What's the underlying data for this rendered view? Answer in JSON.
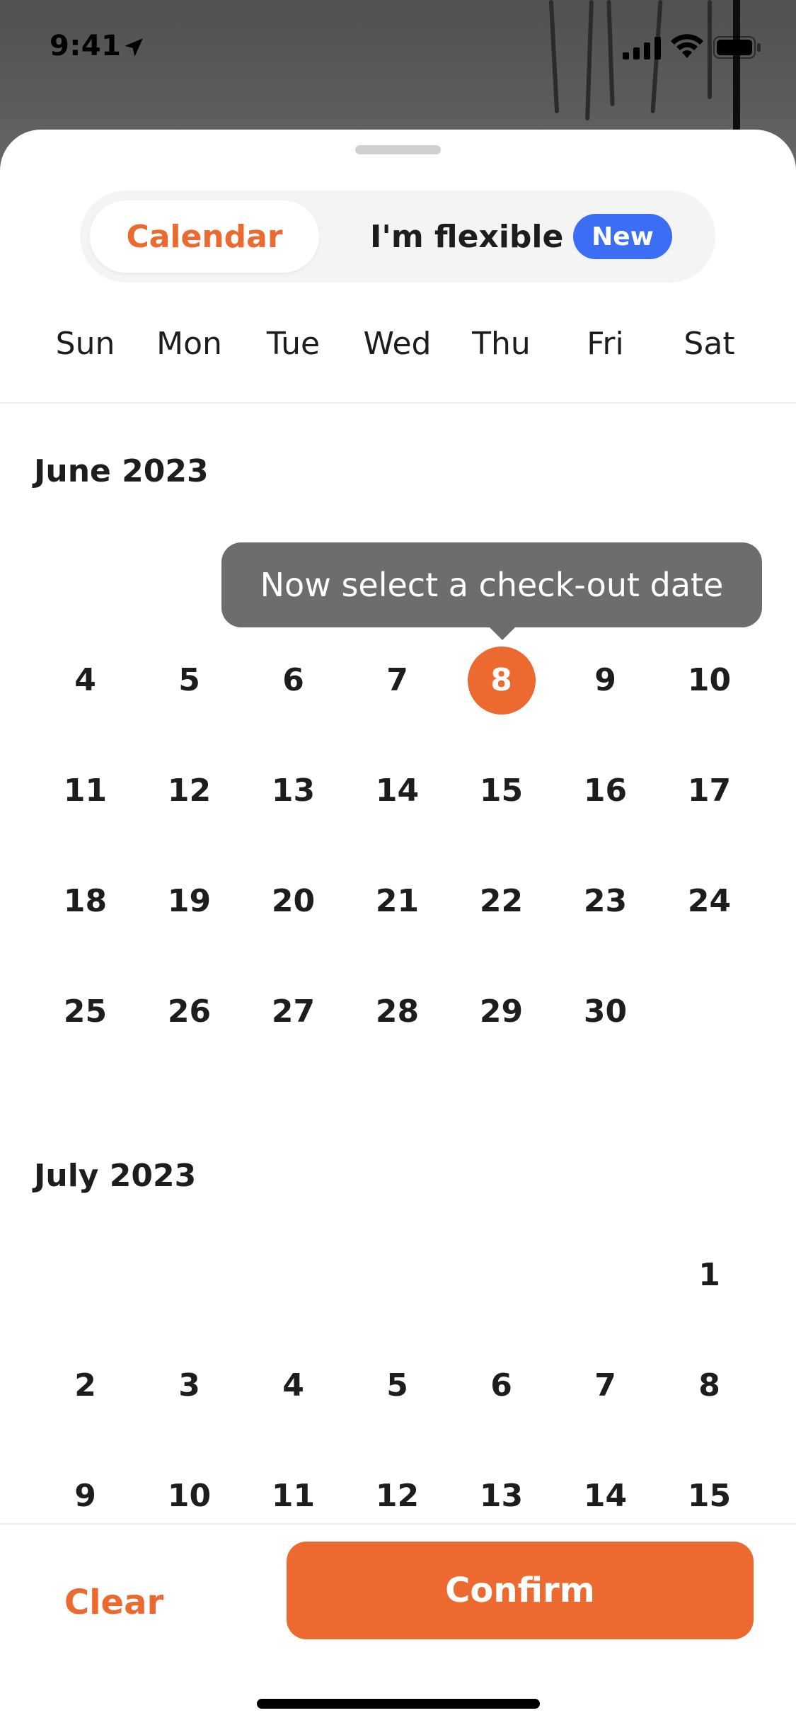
{
  "status_bar": {
    "time": "9:41",
    "icons": [
      "location-arrow-icon",
      "signal-icon",
      "wifi-icon",
      "battery-icon"
    ]
  },
  "segmented": {
    "calendar_label": "Calendar",
    "flexible_label": "I'm flexible",
    "new_badge": "New",
    "active": "Calendar"
  },
  "weekdays": [
    "Sun",
    "Mon",
    "Tue",
    "Wed",
    "Thu",
    "Fri",
    "Sat"
  ],
  "tooltip": "Now select a check-out date",
  "months": [
    {
      "title": "June 2023",
      "first_weekday": 4,
      "days_visible": 30,
      "selected": 8
    },
    {
      "title": "July 2023",
      "first_weekday": 6,
      "days_visible": 15
    }
  ],
  "footer": {
    "clear_label": "Clear",
    "confirm_label": "Confirm"
  },
  "colors": {
    "accent": "#ec6a2f",
    "badge": "#3b6ef5",
    "tooltip": "#6d6d6d"
  }
}
